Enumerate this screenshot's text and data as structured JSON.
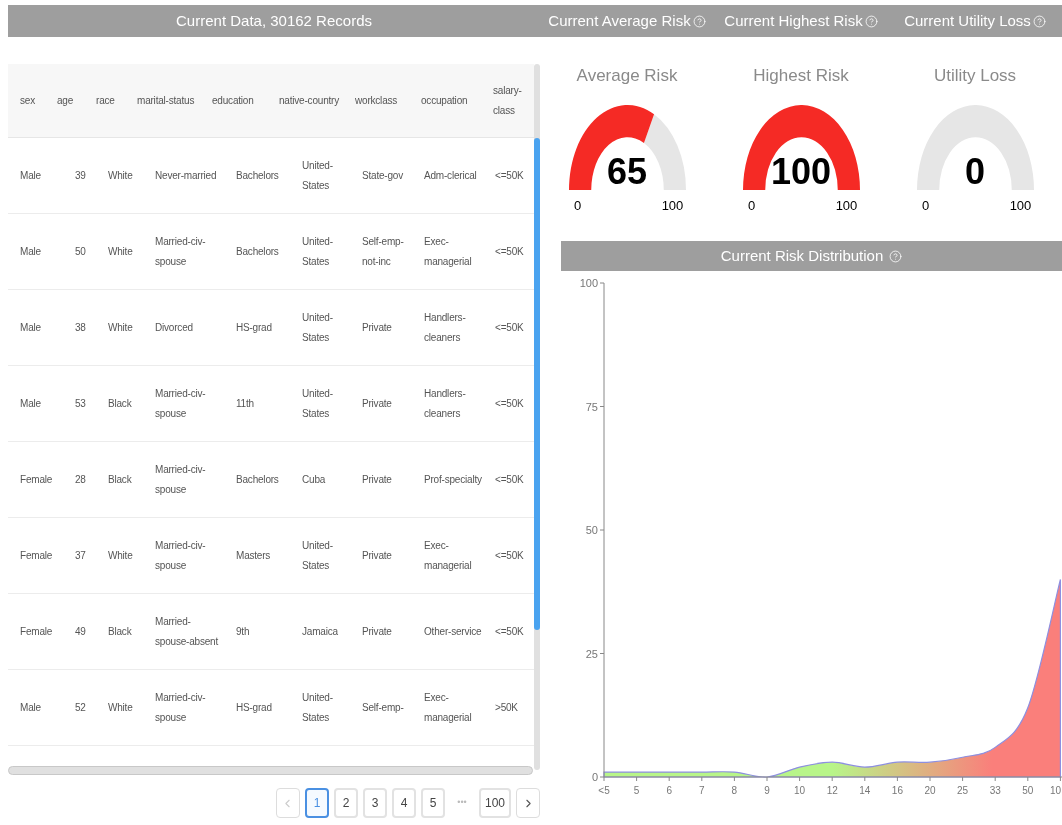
{
  "header": {
    "data_title": "Current Data, 30162 Records",
    "metric_titles": [
      "Current Average Risk",
      "Current Highest Risk",
      "Current Utility Loss"
    ]
  },
  "table": {
    "columns": [
      "sex",
      "age",
      "race",
      "marital-status",
      "education",
      "native-country",
      "workclass",
      "occupation",
      "salary-class"
    ],
    "rows": [
      [
        "Male",
        "39",
        "White",
        "Never-married",
        "Bachelors",
        "United-States",
        "State-gov",
        "Adm-clerical",
        "<=50K"
      ],
      [
        "Male",
        "50",
        "White",
        "Married-civ-spouse",
        "Bachelors",
        "United-States",
        "Self-emp-not-inc",
        "Exec-managerial",
        "<=50K"
      ],
      [
        "Male",
        "38",
        "White",
        "Divorced",
        "HS-grad",
        "United-States",
        "Private",
        "Handlers-cleaners",
        "<=50K"
      ],
      [
        "Male",
        "53",
        "Black",
        "Married-civ-spouse",
        "11th",
        "United-States",
        "Private",
        "Handlers-cleaners",
        "<=50K"
      ],
      [
        "Female",
        "28",
        "Black",
        "Married-civ-spouse",
        "Bachelors",
        "Cuba",
        "Private",
        "Prof-specialty",
        "<=50K"
      ],
      [
        "Female",
        "37",
        "White",
        "Married-civ-spouse",
        "Masters",
        "United-States",
        "Private",
        "Exec-managerial",
        "<=50K"
      ],
      [
        "Female",
        "49",
        "Black",
        "Married-spouse-absent",
        "9th",
        "Jamaica",
        "Private",
        "Other-service",
        "<=50K"
      ],
      [
        "Male",
        "52",
        "White",
        "Married-civ-spouse",
        "HS-grad",
        "United-States",
        "Self-emp-",
        "Exec-managerial",
        ">50K"
      ]
    ]
  },
  "pagination": {
    "prev_disabled": true,
    "next_disabled": false,
    "pages": [
      {
        "label": "1",
        "selected": true
      },
      {
        "label": "2",
        "selected": false
      },
      {
        "label": "3",
        "selected": false
      },
      {
        "label": "4",
        "selected": false
      },
      {
        "label": "5",
        "selected": false
      },
      {
        "label": "•••",
        "selected": false,
        "kind": "ellipsis"
      },
      {
        "label": "100",
        "selected": false
      }
    ]
  },
  "gauges": [
    {
      "title": "Average Risk",
      "value": "65",
      "min": "0",
      "max": "100"
    },
    {
      "title": "Highest Risk",
      "value": "100",
      "min": "0",
      "max": "100"
    },
    {
      "title": "Utility Loss",
      "value": "0",
      "min": "0",
      "max": "100"
    }
  ],
  "distribution": {
    "title": "Current Risk Distribution",
    "chart_data": {
      "type": "area",
      "categories": [
        "<5",
        "5",
        "6",
        "7",
        "8",
        "9",
        "10",
        "12",
        "14",
        "16",
        "20",
        "25",
        "33",
        "50",
        "10"
      ],
      "series": [
        {
          "color": "#8d8fe0",
          "values": [
            1,
            1,
            1,
            1,
            1,
            0,
            2,
            3,
            2,
            3,
            3,
            4,
            6,
            14,
            40
          ]
        }
      ],
      "ylim": [
        0,
        100
      ],
      "yticks": [
        0,
        25,
        50,
        75,
        100
      ]
    }
  }
}
